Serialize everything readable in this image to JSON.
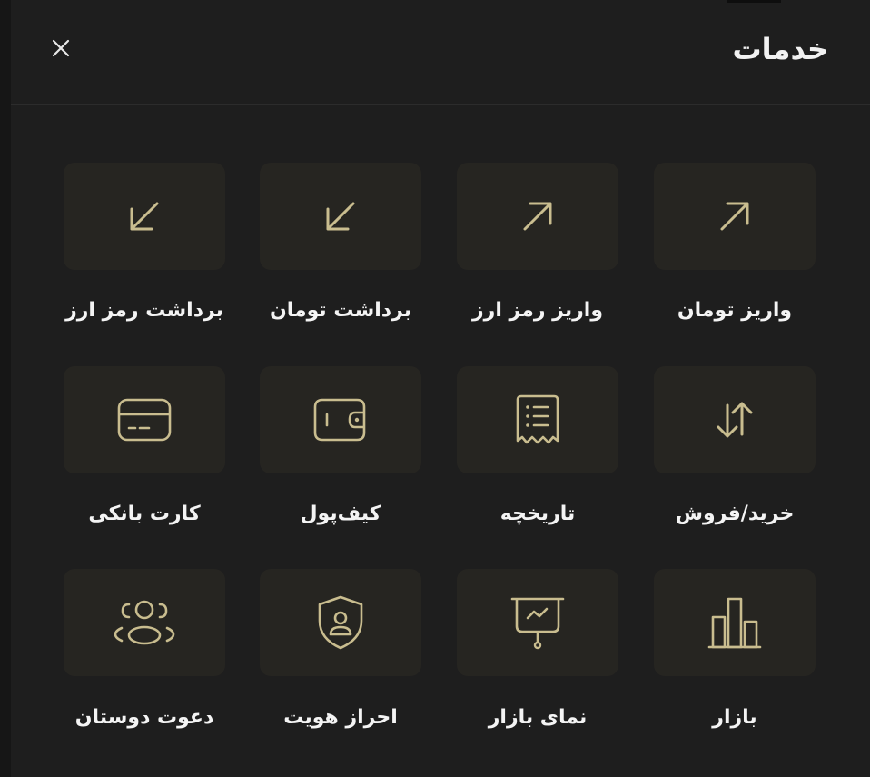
{
  "header": {
    "title": "خدمات",
    "close_icon": "close-icon"
  },
  "accent_color": "#c9bd8f",
  "tile_color": "#262521",
  "services": [
    {
      "label": "واریز تومان",
      "icon": "arrow-up-right-icon"
    },
    {
      "label": "واریز رمز ارز",
      "icon": "arrow-up-right-icon"
    },
    {
      "label": "برداشت تومان",
      "icon": "arrow-down-left-icon"
    },
    {
      "label": "برداشت رمز ارز",
      "icon": "arrow-down-left-icon"
    },
    {
      "label": "خرید/فروش",
      "icon": "swap-arrows-icon"
    },
    {
      "label": "تاریخچه",
      "icon": "receipt-icon"
    },
    {
      "label": "کیف‌پول",
      "icon": "wallet-icon"
    },
    {
      "label": "کارت بانکی",
      "icon": "credit-card-icon"
    },
    {
      "label": "بازار",
      "icon": "bar-chart-icon"
    },
    {
      "label": "نمای بازار",
      "icon": "presentation-chart-icon"
    },
    {
      "label": "احراز هویت",
      "icon": "shield-user-icon"
    },
    {
      "label": "دعوت دوستان",
      "icon": "users-group-icon"
    }
  ]
}
